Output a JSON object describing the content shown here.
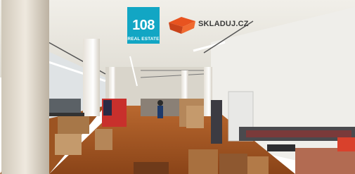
{
  "logo_108": {
    "number": "108",
    "subtitle": "REAL ESTATE",
    "color": "#12a6c4"
  },
  "logo_skladuj": {
    "text": "SKLADUJ.CZ",
    "icon": "box-icon",
    "accent_color": "#e8531f"
  }
}
